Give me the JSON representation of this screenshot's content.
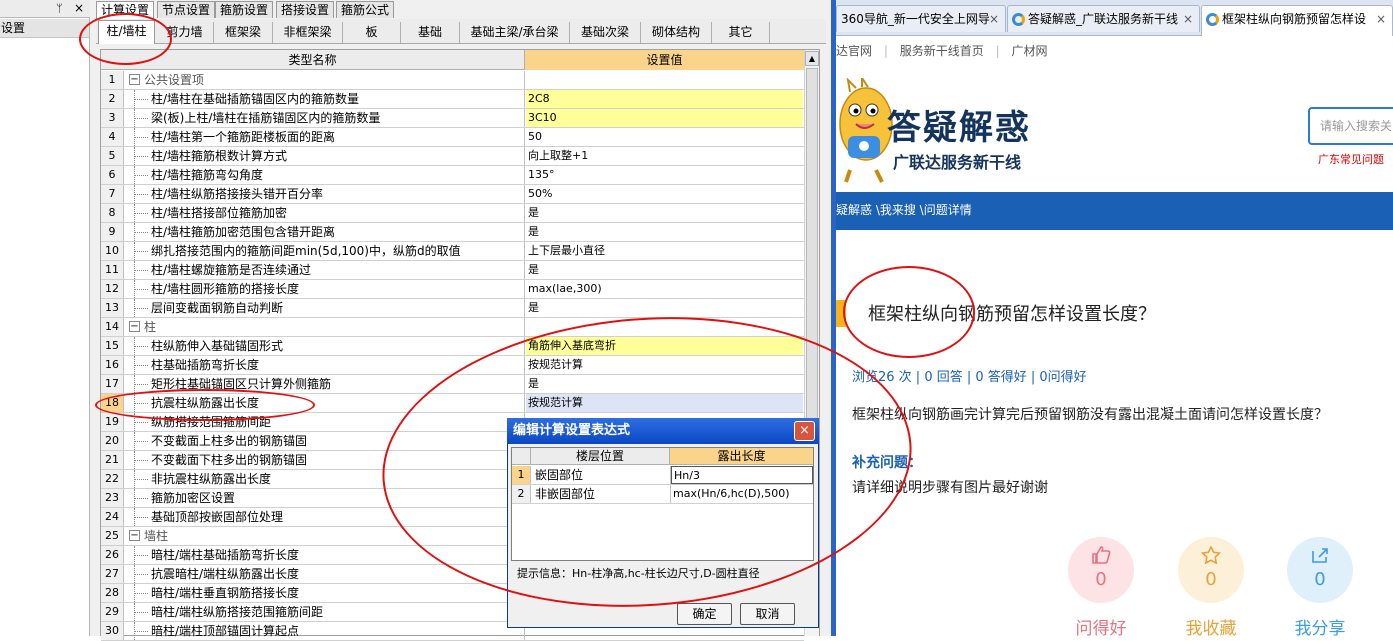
{
  "left_panel": {
    "item": "设置",
    "pin": "ᛘ",
    "close": "×"
  },
  "top_tabs": [
    "计算设置",
    "节点设置",
    "箍筋设置",
    "搭接设置",
    "箍筋公式"
  ],
  "sub_tabs": [
    "柱/墙柱",
    "剪力墙",
    "框架梁",
    "非框架梁",
    "板",
    "基础",
    "基础主梁/承台梁",
    "基础次梁",
    "砌体结构",
    "其它"
  ],
  "grid": {
    "col_name": "类型名称",
    "col_value": "设置值",
    "rows": [
      {
        "n": "1",
        "name": "公共设置项",
        "value": "",
        "group": true
      },
      {
        "n": "2",
        "name": "柱/墙柱在基础插筋锚固区内的箍筋数量",
        "value": "2C8",
        "hl": true
      },
      {
        "n": "3",
        "name": "梁(板)上柱/墙柱在插筋锚固区内的箍筋数量",
        "value": "3C10",
        "hl": true
      },
      {
        "n": "4",
        "name": "柱/墙柱第一个箍筋距楼板面的距离",
        "value": "50"
      },
      {
        "n": "5",
        "name": "柱/墙柱箍筋根数计算方式",
        "value": "向上取整+1"
      },
      {
        "n": "6",
        "name": "柱/墙柱箍筋弯勾角度",
        "value": "135°"
      },
      {
        "n": "7",
        "name": "柱/墙柱纵筋搭接接头错开百分率",
        "value": "50%"
      },
      {
        "n": "8",
        "name": "柱/墙柱搭接部位箍筋加密",
        "value": "是"
      },
      {
        "n": "9",
        "name": "柱/墙柱箍筋加密范围包含错开距离",
        "value": "是"
      },
      {
        "n": "10",
        "name": "绑扎搭接范围内的箍筋间距min(5d,100)中，纵筋d的取值",
        "value": "上下层最小直径"
      },
      {
        "n": "11",
        "name": "柱/墙柱螺旋箍筋是否连续通过",
        "value": "是"
      },
      {
        "n": "12",
        "name": "柱/墙柱圆形箍筋的搭接长度",
        "value": "max(lae,300)"
      },
      {
        "n": "13",
        "name": "层间变截面钢筋自动判断",
        "value": "是"
      },
      {
        "n": "14",
        "name": "柱",
        "value": "",
        "group": true
      },
      {
        "n": "15",
        "name": "柱纵筋伸入基础锚固形式",
        "value": "角筋伸入基底弯折",
        "hl": true
      },
      {
        "n": "16",
        "name": "柱基础插筋弯折长度",
        "value": "按规范计算"
      },
      {
        "n": "17",
        "name": "矩形柱基础锚固区只计算外侧箍筋",
        "value": "是"
      },
      {
        "n": "18",
        "name": "抗震柱纵筋露出长度",
        "value": "按规范计算",
        "sel": true
      },
      {
        "n": "19",
        "name": "纵筋搭接范围箍筋间距",
        "value": ""
      },
      {
        "n": "20",
        "name": "不变截面上柱多出的钢筋锚固",
        "value": ""
      },
      {
        "n": "21",
        "name": "不变截面下柱多出的钢筋锚固",
        "value": ""
      },
      {
        "n": "22",
        "name": "非抗震柱纵筋露出长度",
        "value": ""
      },
      {
        "n": "23",
        "name": "箍筋加密区设置",
        "value": ""
      },
      {
        "n": "24",
        "name": "基础顶部按嵌固部位处理",
        "value": ""
      },
      {
        "n": "25",
        "name": "墙柱",
        "value": "",
        "group": true
      },
      {
        "n": "26",
        "name": "暗柱/端柱基础插筋弯折长度",
        "value": ""
      },
      {
        "n": "27",
        "name": "抗震暗柱/端柱纵筋露出长度",
        "value": ""
      },
      {
        "n": "28",
        "name": "暗柱/端柱垂直钢筋搭接长度",
        "value": ""
      },
      {
        "n": "29",
        "name": "暗柱/端柱纵筋搭接范围箍筋间距",
        "value": ""
      },
      {
        "n": "30",
        "name": "暗柱/端柱顶部锚固计算起点",
        "value": ""
      }
    ]
  },
  "dialog": {
    "title": "编辑计算设置表达式",
    "close": "×",
    "col_pos": "楼层位置",
    "col_len": "露出长度",
    "rows": [
      {
        "n": "1",
        "pos": "嵌固部位",
        "len": "Hn/3"
      },
      {
        "n": "2",
        "pos": "非嵌固部位",
        "len": "max(Hn/6,hc(D),500)"
      }
    ],
    "hint": "提示信息：Hn-柱净高,hc-柱长边尺寸,D-圆柱直径",
    "ok": "确定",
    "cancel": "取消"
  },
  "browser": {
    "tabs": [
      {
        "label": "360导航_新一代安全上网导",
        "active": false
      },
      {
        "label": "答疑解惑_广联达服务新干线",
        "active": false
      },
      {
        "label": "框架柱纵向钢筋预留怎样设",
        "active": true
      }
    ],
    "tab_close": "×",
    "nav": [
      "达官网",
      "服务新干线首页",
      "广材网"
    ],
    "nav_sep": "|",
    "logo_title": "答疑解惑",
    "logo_sub": "广联达服务新干线",
    "search_placeholder": "请输入搜索关",
    "hot_link": "广东常见问题",
    "breadcrumb": "疑解惑 \\我来搜 \\问题详情",
    "question_title": "框架柱纵向钢筋预留怎样设置长度？",
    "stats": "浏览26 次 | 0 回答 | 0 答得好 | 0问得好",
    "question_desc": "框架柱纵向钢筋画完计算完后预留钢筋没有露出混凝土面请问怎样设置长度？",
    "supplement_label": "补充问题：",
    "supplement_text": "请详细说明步骤有图片最好谢谢",
    "actions": [
      {
        "label": "问得好",
        "count": "0",
        "icon": "thumbs-up-icon",
        "color": "#e8737f",
        "bg": "#fde3e6"
      },
      {
        "label": "我收藏",
        "count": "0",
        "icon": "star-icon",
        "color": "#e7a23a",
        "bg": "#fdf0d8"
      },
      {
        "label": "我分享",
        "count": "0",
        "icon": "share-icon",
        "color": "#3a9ee0",
        "bg": "#dff0fb"
      }
    ]
  }
}
